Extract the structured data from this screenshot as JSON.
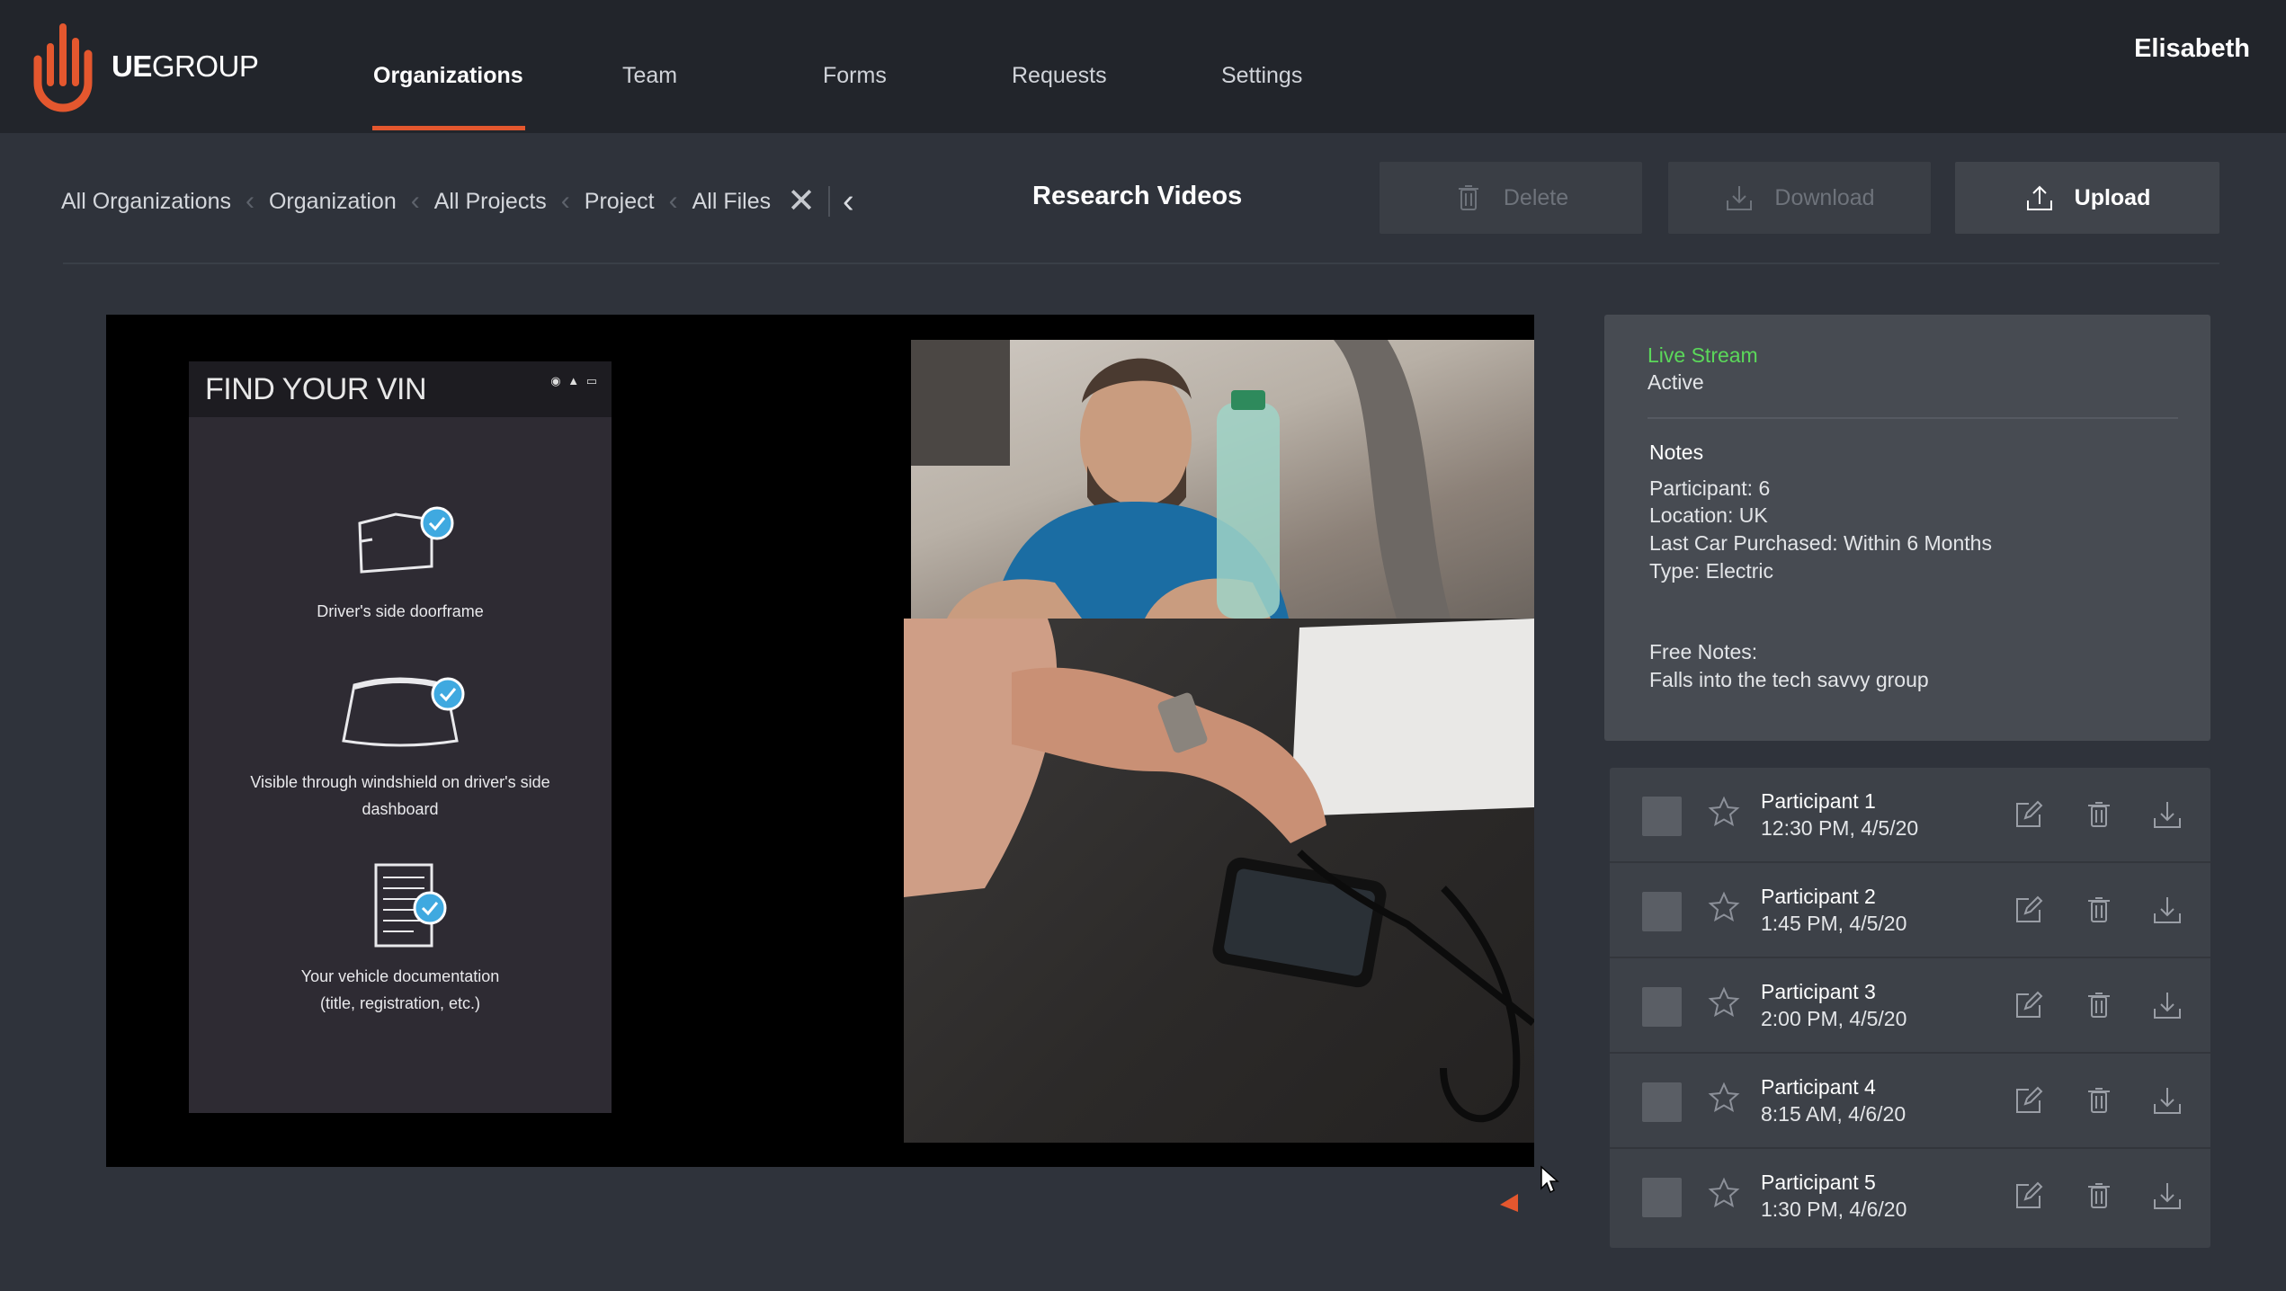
{
  "brand": {
    "name_bold": "UE",
    "name_rest": "GROUP",
    "color": "#e4572e"
  },
  "nav": {
    "items": [
      {
        "label": "Organizations",
        "active": true
      },
      {
        "label": "Team",
        "active": false
      },
      {
        "label": "Forms",
        "active": false
      },
      {
        "label": "Requests",
        "active": false
      },
      {
        "label": "Settings",
        "active": false
      }
    ],
    "accent": "#e4572e"
  },
  "user": {
    "name": "Elisabeth"
  },
  "breadcrumb": [
    "All Organizations",
    "Organization",
    "All Projects",
    "Project",
    "All Files"
  ],
  "page": {
    "title": "Research Videos"
  },
  "toolbar": {
    "delete_label": "Delete",
    "download_label": "Download",
    "upload_label": "Upload"
  },
  "video": {
    "phone_title": "FIND YOUR VIN",
    "items": [
      {
        "line1": "Driver's side doorframe",
        "line2": ""
      },
      {
        "line1": "Visible through windshield on driver's side",
        "line2": "dashboard"
      },
      {
        "line1": "Your vehicle documentation",
        "line2": "(title, registration, etc.)"
      }
    ]
  },
  "info_panel": {
    "stream_label": "Live Stream",
    "stream_status": "Active",
    "status_color": "#5bd85a",
    "notes_title": "Notes",
    "notes": [
      "Participant: 6",
      "Location: UK",
      "Last Car Purchased: Within 6 Months",
      "Type: Electric"
    ],
    "free_notes_label": "Free Notes:",
    "free_notes": "Falls into the tech savvy group"
  },
  "participants": [
    {
      "name": "Participant 1",
      "time": "12:30 PM, 4/5/20"
    },
    {
      "name": "Participant 2",
      "time": "1:45 PM, 4/5/20"
    },
    {
      "name": "Participant 3",
      "time": "2:00 PM, 4/5/20"
    },
    {
      "name": "Participant 4",
      "time": "8:15 AM, 4/6/20"
    },
    {
      "name": "Participant 5",
      "time": "1:30 PM, 4/6/20"
    }
  ]
}
